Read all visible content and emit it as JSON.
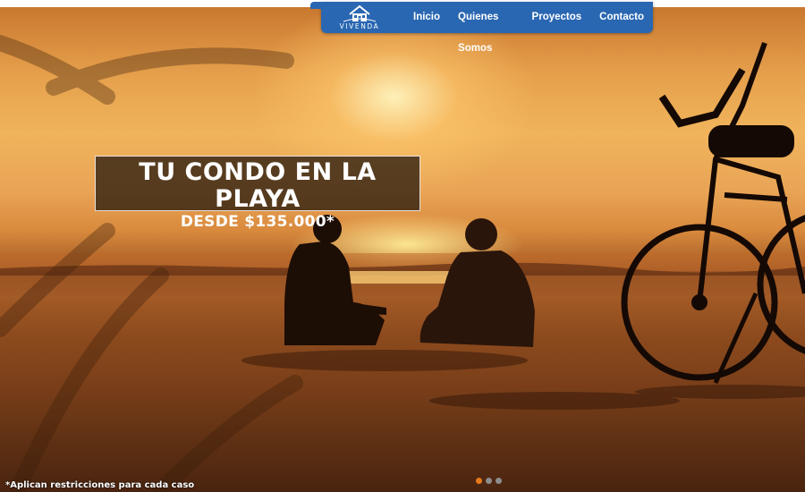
{
  "header": {
    "logo_text": "VIVENDA",
    "nav_items": [
      "Inicio",
      "Quienes Somos",
      "Proyectos",
      "Contacto"
    ]
  },
  "hero": {
    "headline": "TU CONDO EN LA PLAYA",
    "subheadline": "DESDE $135.000*",
    "disclaimer": "*Aplican restricciones para cada caso"
  },
  "slider": {
    "slide_count": 3,
    "active_index": 0,
    "active_color": "#e67a1e",
    "inactive_color": "#8d8d8d"
  },
  "colors": {
    "nav_bg": "#2a67b2",
    "caption_bg": "rgba(45,30,15,0.78)"
  }
}
